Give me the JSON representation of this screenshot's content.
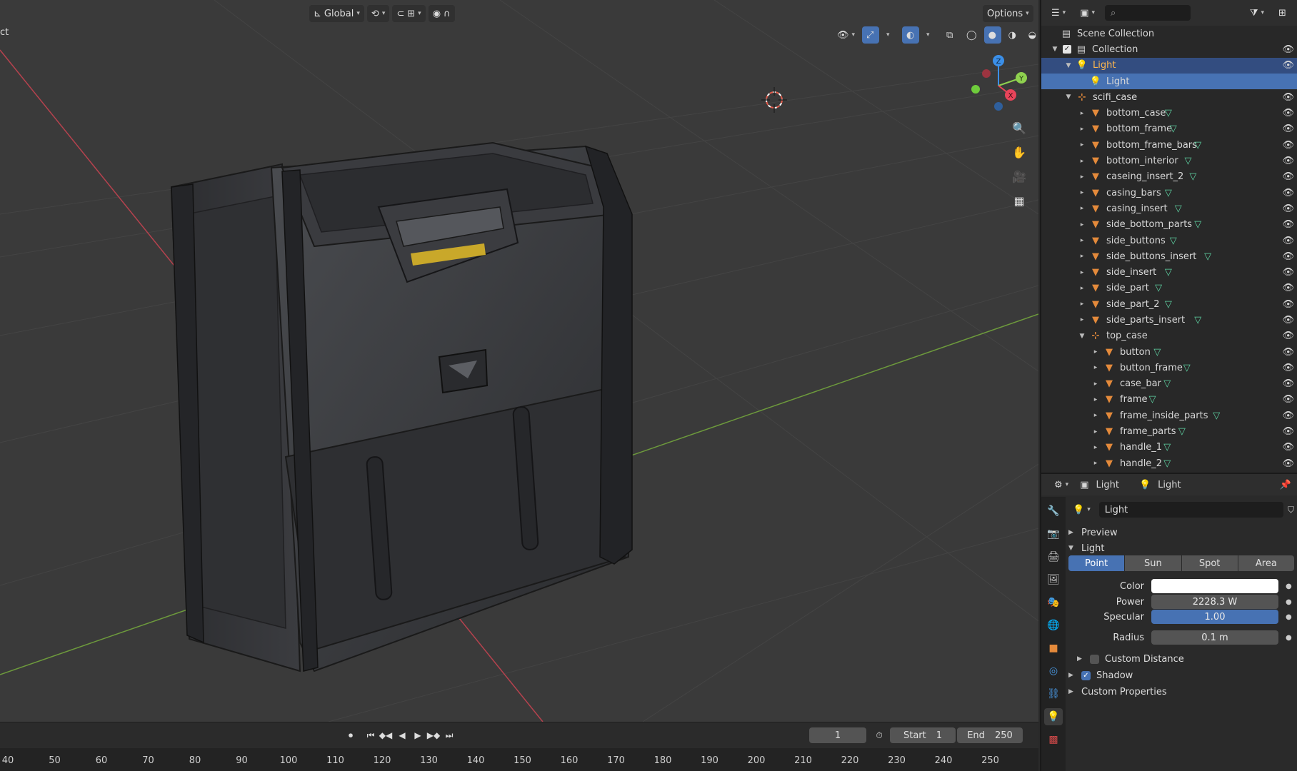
{
  "viewport": {
    "active_object_label": "ct",
    "header": {
      "orientation_label": "Global",
      "options_label": "Options"
    },
    "gizmo": {
      "z_label": "Z",
      "y_label": "Y",
      "x_label": "X"
    }
  },
  "timeline": {
    "current_frame": "1",
    "start_label": "Start",
    "start_value": "1",
    "end_label": "End",
    "end_value": "250",
    "ticks": [
      "40",
      "50",
      "60",
      "70",
      "80",
      "90",
      "100",
      "110",
      "120",
      "130",
      "140",
      "150",
      "160",
      "170",
      "180",
      "190",
      "200",
      "210",
      "220",
      "230",
      "240",
      "250"
    ]
  },
  "outliner": {
    "search_placeholder": "",
    "scene_collection": "Scene Collection",
    "rows": [
      {
        "name": "Collection",
        "type": "collection",
        "depth": 1,
        "expanded": true
      },
      {
        "name": "Light",
        "type": "light-object",
        "depth": 2,
        "expanded": true,
        "state": "selected"
      },
      {
        "name": "Light",
        "type": "light-data",
        "depth": 3,
        "state": "active"
      },
      {
        "name": "scifi_case",
        "type": "empty",
        "depth": 2,
        "expanded": true
      },
      {
        "name": "bottom_case",
        "type": "mesh",
        "depth": 3
      },
      {
        "name": "bottom_frame",
        "type": "mesh",
        "depth": 3
      },
      {
        "name": "bottom_frame_bars",
        "type": "mesh",
        "depth": 3
      },
      {
        "name": "bottom_interior",
        "type": "mesh",
        "depth": 3
      },
      {
        "name": "caseing_insert_2",
        "type": "mesh",
        "depth": 3
      },
      {
        "name": "casing_bars",
        "type": "mesh",
        "depth": 3
      },
      {
        "name": "casing_insert",
        "type": "mesh",
        "depth": 3
      },
      {
        "name": "side_bottom_parts",
        "type": "mesh",
        "depth": 3
      },
      {
        "name": "side_buttons",
        "type": "mesh",
        "depth": 3
      },
      {
        "name": "side_buttons_insert",
        "type": "mesh",
        "depth": 3
      },
      {
        "name": "side_insert",
        "type": "mesh",
        "depth": 3
      },
      {
        "name": "side_part",
        "type": "mesh",
        "depth": 3
      },
      {
        "name": "side_part_2",
        "type": "mesh",
        "depth": 3
      },
      {
        "name": "side_parts_insert",
        "type": "mesh",
        "depth": 3
      },
      {
        "name": "top_case",
        "type": "empty",
        "depth": 3,
        "expanded": true
      },
      {
        "name": "button",
        "type": "mesh",
        "depth": 4
      },
      {
        "name": "button_frame",
        "type": "mesh",
        "depth": 4
      },
      {
        "name": "case_bar",
        "type": "mesh",
        "depth": 4
      },
      {
        "name": "frame",
        "type": "mesh",
        "depth": 4
      },
      {
        "name": "frame_inside_parts",
        "type": "mesh",
        "depth": 4
      },
      {
        "name": "frame_parts",
        "type": "mesh",
        "depth": 4
      },
      {
        "name": "handle_1",
        "type": "mesh",
        "depth": 4
      },
      {
        "name": "handle_2",
        "type": "mesh",
        "depth": 4
      }
    ]
  },
  "properties": {
    "breadcrumb": [
      "Light",
      "Light"
    ],
    "datablock_name": "Light",
    "panels": {
      "preview": "Preview",
      "light": "Light",
      "custom_distance": "Custom Distance",
      "shadow": "Shadow",
      "custom_properties": "Custom Properties"
    },
    "light_types": [
      "Point",
      "Sun",
      "Spot",
      "Area"
    ],
    "active_light_type": "Point",
    "fields": {
      "color_label": "Color",
      "color_value": "#ffffff",
      "power_label": "Power",
      "power_value": "2228.3 W",
      "specular_label": "Specular",
      "specular_value": "1.00",
      "radius_label": "Radius",
      "radius_value": "0.1 m"
    },
    "shadow_enabled": true,
    "custom_distance_enabled": false
  },
  "colors": {
    "accent": "#4772b3",
    "mesh_icon": "#e48a3b",
    "data_icon": "#5fd3a3",
    "axis_x": "#e8445a",
    "axis_y": "#8fd14f",
    "axis_z": "#3b8fe8",
    "handle_stripe": "#c9a82a"
  }
}
